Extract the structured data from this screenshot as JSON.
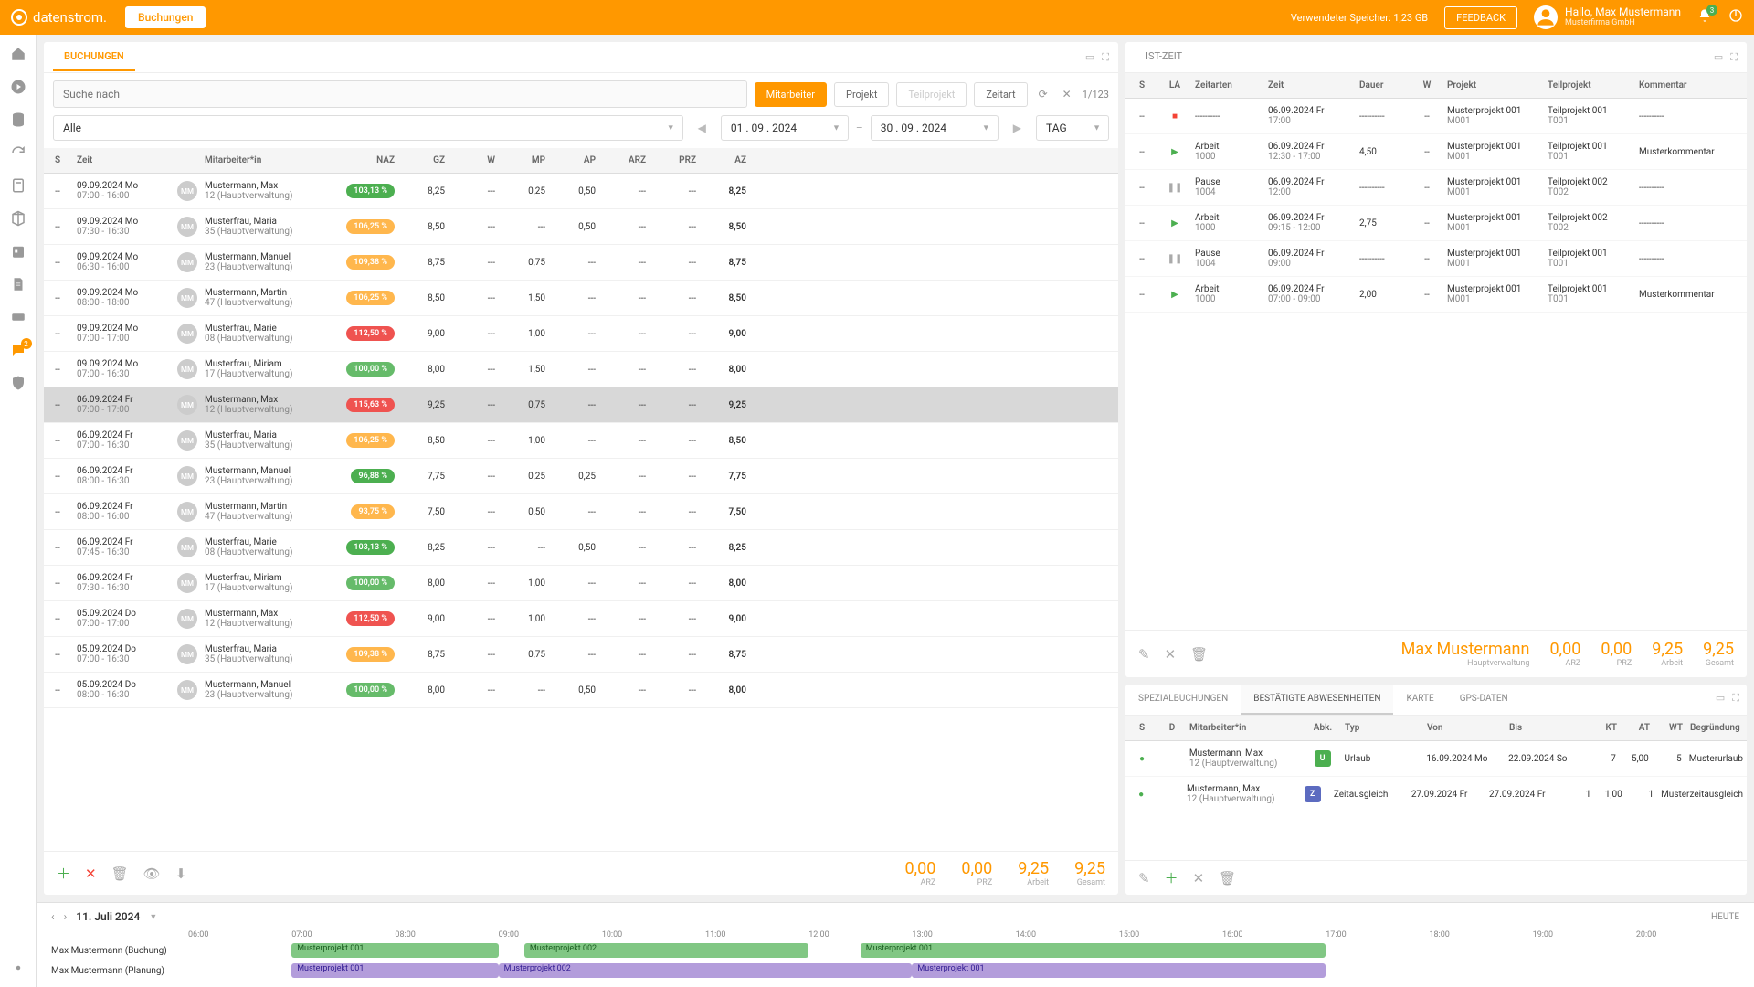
{
  "header": {
    "brand": "datenstrom.",
    "tab": "Buchungen",
    "storage": "Verwendeter Speicher: 1,23 GB",
    "feedback": "FEEDBACK",
    "greeting": "Hallo, Max Mustermann",
    "company": "Musterfirma GmbH",
    "bell_count": "3"
  },
  "left": {
    "title": "BUCHUNGEN",
    "search_ph": "Suche nach",
    "pills": [
      "Mitarbeiter",
      "Projekt",
      "Teilprojekt",
      "Zeitart"
    ],
    "pager": "1/123",
    "filter_all": "Alle",
    "date_from": "01 . 09 . 2024",
    "date_to": "30 . 09 . 2024",
    "gran": "TAG",
    "cols": {
      "s": "S",
      "zeit": "Zeit",
      "mit": "Mitarbeiter*in",
      "naz": "NAZ",
      "gz": "GZ",
      "w": "W",
      "mp": "MP",
      "ap": "AP",
      "arz": "ARZ",
      "prz": "PRZ",
      "az": "AZ"
    },
    "rows": [
      {
        "d": "09.09.2024 Mo",
        "t": "07:00 - 16:00",
        "n": "Mustermann, Max",
        "o": "12 (Hauptverwaltung)",
        "naz": "103,13 %",
        "c": "#4caf50",
        "gz": "8,25",
        "w": "---",
        "mp": "0,25",
        "ap": "0,50",
        "arz": "---",
        "prz": "---",
        "az": "8,25"
      },
      {
        "d": "09.09.2024 Mo",
        "t": "07:30 - 16:30",
        "n": "Musterfrau, Maria",
        "o": "35 (Hauptverwaltung)",
        "naz": "106,25 %",
        "c": "#ffb74d",
        "gz": "8,50",
        "w": "---",
        "mp": "---",
        "ap": "0,50",
        "arz": "---",
        "prz": "---",
        "az": "8,50"
      },
      {
        "d": "09.09.2024 Mo",
        "t": "06:30 - 16:00",
        "n": "Mustermann, Manuel",
        "o": "23 (Hauptverwaltung)",
        "naz": "109,38 %",
        "c": "#ffb74d",
        "gz": "8,75",
        "w": "---",
        "mp": "0,75",
        "ap": "---",
        "arz": "---",
        "prz": "---",
        "az": "8,75"
      },
      {
        "d": "09.09.2024 Mo",
        "t": "08:00 - 18:00",
        "n": "Mustermann, Martin",
        "o": "47 (Hauptverwaltung)",
        "naz": "106,25 %",
        "c": "#ffb74d",
        "gz": "8,50",
        "w": "---",
        "mp": "1,50",
        "ap": "---",
        "arz": "---",
        "prz": "---",
        "az": "8,50"
      },
      {
        "d": "09.09.2024 Mo",
        "t": "07:00 - 17:00",
        "n": "Musterfrau, Marie",
        "o": "08 (Hauptverwaltung)",
        "naz": "112,50 %",
        "c": "#ef5350",
        "gz": "9,00",
        "w": "---",
        "mp": "1,00",
        "ap": "---",
        "arz": "---",
        "prz": "---",
        "az": "9,00"
      },
      {
        "d": "09.09.2024 Mo",
        "t": "07:00 - 16:30",
        "n": "Musterfrau, Miriam",
        "o": "17 (Hauptverwaltung)",
        "naz": "100,00 %",
        "c": "#66bb6a",
        "gz": "8,00",
        "w": "---",
        "mp": "1,50",
        "ap": "---",
        "arz": "---",
        "prz": "---",
        "az": "8,00"
      },
      {
        "d": "06.09.2024 Fr",
        "t": "07:00 - 17:00",
        "n": "Mustermann, Max",
        "o": "12 (Hauptverwaltung)",
        "naz": "115,63 %",
        "c": "#ef5350",
        "gz": "9,25",
        "w": "---",
        "mp": "0,75",
        "ap": "---",
        "arz": "---",
        "prz": "---",
        "az": "9,25",
        "sel": true
      },
      {
        "d": "06.09.2024 Fr",
        "t": "07:00 - 16:30",
        "n": "Musterfrau, Maria",
        "o": "35 (Hauptverwaltung)",
        "naz": "106,25 %",
        "c": "#ffb74d",
        "gz": "8,50",
        "w": "---",
        "mp": "1,00",
        "ap": "---",
        "arz": "---",
        "prz": "---",
        "az": "8,50"
      },
      {
        "d": "06.09.2024 Fr",
        "t": "08:00 - 16:30",
        "n": "Mustermann, Manuel",
        "o": "23 (Hauptverwaltung)",
        "naz": "96,88 %",
        "c": "#4caf50",
        "gz": "7,75",
        "w": "---",
        "mp": "0,25",
        "ap": "0,25",
        "arz": "---",
        "prz": "---",
        "az": "7,75"
      },
      {
        "d": "06.09.2024 Fr",
        "t": "08:00 - 16:00",
        "n": "Mustermann, Martin",
        "o": "47 (Hauptverwaltung)",
        "naz": "93,75 %",
        "c": "#ffb74d",
        "gz": "7,50",
        "w": "---",
        "mp": "0,50",
        "ap": "---",
        "arz": "---",
        "prz": "---",
        "az": "7,50"
      },
      {
        "d": "06.09.2024 Fr",
        "t": "07:45 - 16:30",
        "n": "Musterfrau, Marie",
        "o": "08 (Hauptverwaltung)",
        "naz": "103,13 %",
        "c": "#4caf50",
        "gz": "8,25",
        "w": "---",
        "mp": "---",
        "ap": "0,50",
        "arz": "---",
        "prz": "---",
        "az": "8,25"
      },
      {
        "d": "06.09.2024 Fr",
        "t": "07:30 - 16:30",
        "n": "Musterfrau, Miriam",
        "o": "17 (Hauptverwaltung)",
        "naz": "100,00 %",
        "c": "#66bb6a",
        "gz": "8,00",
        "w": "---",
        "mp": "1,00",
        "ap": "---",
        "arz": "---",
        "prz": "---",
        "az": "8,00"
      },
      {
        "d": "05.09.2024 Do",
        "t": "07:00 - 17:00",
        "n": "Mustermann, Max",
        "o": "12 (Hauptverwaltung)",
        "naz": "112,50 %",
        "c": "#ef5350",
        "gz": "9,00",
        "w": "---",
        "mp": "1,00",
        "ap": "---",
        "arz": "---",
        "prz": "---",
        "az": "9,00"
      },
      {
        "d": "05.09.2024 Do",
        "t": "07:00 - 16:30",
        "n": "Musterfrau, Maria",
        "o": "35 (Hauptverwaltung)",
        "naz": "109,38 %",
        "c": "#ffb74d",
        "gz": "8,75",
        "w": "---",
        "mp": "0,75",
        "ap": "---",
        "arz": "---",
        "prz": "---",
        "az": "8,75"
      },
      {
        "d": "05.09.2024 Do",
        "t": "08:00 - 16:30",
        "n": "Mustermann, Manuel",
        "o": "23 (Hauptverwaltung)",
        "naz": "100,00 %",
        "c": "#66bb6a",
        "gz": "8,00",
        "w": "---",
        "mp": "---",
        "ap": "0,50",
        "arz": "---",
        "prz": "---",
        "az": "8,00"
      }
    ],
    "totals": [
      {
        "v": "0,00",
        "l": "ARZ"
      },
      {
        "v": "0,00",
        "l": "PRZ"
      },
      {
        "v": "9,25",
        "l": "Arbeit"
      },
      {
        "v": "9,25",
        "l": "Gesamt"
      }
    ]
  },
  "rt": {
    "title": "IST-ZEIT",
    "cols": {
      "s": "S",
      "la": "LA",
      "za": "Zeitarten",
      "zt": "Zeit",
      "d": "Dauer",
      "w": "W",
      "p": "Projekt",
      "tp": "Teilprojekt",
      "k": "Kommentar"
    },
    "rows": [
      {
        "la": "rec",
        "za": "----------",
        "zt1": "06.09.2024 Fr",
        "zt2": "17:00",
        "d": "----------",
        "w": "--",
        "p1": "Musterprojekt 001",
        "p2": "M001",
        "tp1": "Teilprojekt 001",
        "tp2": "T001",
        "k": "----------"
      },
      {
        "la": "play",
        "za": "Arbeit",
        "za2": "1000",
        "zt1": "06.09.2024 Fr",
        "zt2": "12:30 - 17:00",
        "d": "4,50",
        "w": "--",
        "p1": "Musterprojekt 001",
        "p2": "M001",
        "tp1": "Teilprojekt 001",
        "tp2": "T001",
        "k": "Musterkommentar"
      },
      {
        "la": "pause",
        "za": "Pause",
        "za2": "1004",
        "zt1": "06.09.2024 Fr",
        "zt2": "12:00",
        "d": "----------",
        "w": "--",
        "p1": "Musterprojekt 001",
        "p2": "M001",
        "tp1": "Teilprojekt 002",
        "tp2": "T002",
        "k": "----------"
      },
      {
        "la": "play",
        "za": "Arbeit",
        "za2": "1000",
        "zt1": "06.09.2024 Fr",
        "zt2": "09:15 - 12:00",
        "d": "2,75",
        "w": "--",
        "p1": "Musterprojekt 001",
        "p2": "M001",
        "tp1": "Teilprojekt 002",
        "tp2": "T002",
        "k": "----------"
      },
      {
        "la": "pause",
        "za": "Pause",
        "za2": "1004",
        "zt1": "06.09.2024 Fr",
        "zt2": "09:00",
        "d": "----------",
        "w": "--",
        "p1": "Musterprojekt 001",
        "p2": "M001",
        "tp1": "Teilprojekt 001",
        "tp2": "T001",
        "k": "----------"
      },
      {
        "la": "play",
        "za": "Arbeit",
        "za2": "1000",
        "zt1": "06.09.2024 Fr",
        "zt2": "07:00 - 09:00",
        "d": "2,00",
        "w": "--",
        "p1": "Musterprojekt 001",
        "p2": "M001",
        "tp1": "Teilprojekt 001",
        "tp2": "T001",
        "k": "Musterkommentar"
      }
    ],
    "fname": "Max Mustermann",
    "fsub": "Hauptverwaltung",
    "ftots": [
      {
        "v": "0,00",
        "l": "ARZ"
      },
      {
        "v": "0,00",
        "l": "PRZ"
      },
      {
        "v": "9,25",
        "l": "Arbeit"
      },
      {
        "v": "9,25",
        "l": "Gesamt"
      }
    ]
  },
  "abs": {
    "tabs": [
      "SPEZIALBUCHUNGEN",
      "BESTÄTIGTE ABWESENHEITEN",
      "KARTE",
      "GPS-DATEN"
    ],
    "cols": {
      "s": "S",
      "d": "D",
      "m": "Mitarbeiter*in",
      "ab": "Abk.",
      "ty": "Typ",
      "vo": "Von",
      "bi": "Bis",
      "kt": "KT",
      "at": "AT",
      "wt": "WT",
      "be": "Begründung"
    },
    "rows": [
      {
        "m1": "Mustermann, Max",
        "m2": "12 (Hauptverwaltung)",
        "ab": "U",
        "abc": "#4caf50",
        "ty": "Urlaub",
        "vo": "16.09.2024 Mo",
        "bi": "22.09.2024 So",
        "kt": "7",
        "at": "5,00",
        "wt": "5",
        "be": "Musterurlaub"
      },
      {
        "m1": "Mustermann, Max",
        "m2": "12 (Hauptverwaltung)",
        "ab": "Z",
        "abc": "#5c6bc0",
        "ty": "Zeitausgleich",
        "vo": "27.09.2024 Fr",
        "bi": "27.09.2024 Fr",
        "kt": "1",
        "at": "1,00",
        "wt": "1",
        "be": "Musterzeitausgleich"
      }
    ]
  },
  "tl": {
    "date": "11. Juli 2024",
    "today": "HEUTE",
    "hours": [
      "06:00",
      "07:00",
      "08:00",
      "09:00",
      "10:00",
      "11:00",
      "12:00",
      "13:00",
      "14:00",
      "15:00",
      "16:00",
      "17:00",
      "18:00",
      "19:00",
      "20:00"
    ],
    "rows": [
      {
        "label": "Max Mustermann (Buchung)",
        "bars": [
          {
            "l": "Musterprojekt 001",
            "c": "g",
            "s": 7,
            "e": 9
          },
          {
            "l": "Musterprojekt 002",
            "c": "g",
            "s": 9.25,
            "e": 12
          },
          {
            "l": "Musterprojekt 001",
            "c": "g",
            "s": 12.5,
            "e": 17
          }
        ]
      },
      {
        "label": "Max Mustermann (Planung)",
        "bars": [
          {
            "l": "Musterprojekt 001",
            "c": "p",
            "s": 7,
            "e": 9
          },
          {
            "l": "Musterprojekt 002",
            "c": "p",
            "s": 9,
            "e": 13
          },
          {
            "l": "Musterprojekt 001",
            "c": "p",
            "s": 13,
            "e": 17
          }
        ]
      }
    ]
  }
}
